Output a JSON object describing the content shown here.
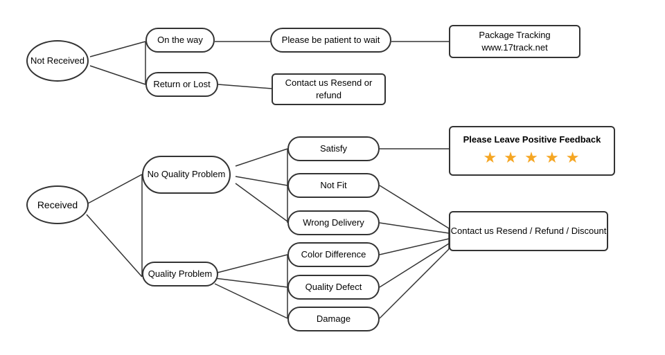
{
  "nodes": {
    "not_received": {
      "label": "Not\nReceived"
    },
    "on_the_way": {
      "label": "On the way"
    },
    "return_or_lost": {
      "label": "Return or Lost"
    },
    "patient": {
      "label": "Please be patient to wait"
    },
    "contact_resend_refund": {
      "label": "Contact us\nResend or refund"
    },
    "package_tracking": {
      "label": "Package Tracking\nwww.17track.net"
    },
    "received": {
      "label": "Received"
    },
    "no_quality_problem": {
      "label": "No\nQuality Problem"
    },
    "quality_problem": {
      "label": "Quality Problem"
    },
    "satisfy": {
      "label": "Satisfy"
    },
    "not_fit": {
      "label": "Not Fit"
    },
    "wrong_delivery": {
      "label": "Wrong Delivery"
    },
    "color_difference": {
      "label": "Color Difference"
    },
    "quality_defect": {
      "label": "Quality Defect"
    },
    "damage": {
      "label": "Damage"
    },
    "please_leave_feedback": {
      "label": "Please Leave Positive Feedback"
    },
    "contact_resend_refund_discount": {
      "label": "Contact us\nResend / Refund / Discount"
    },
    "stars": {
      "label": "★ ★ ★ ★ ★"
    }
  }
}
